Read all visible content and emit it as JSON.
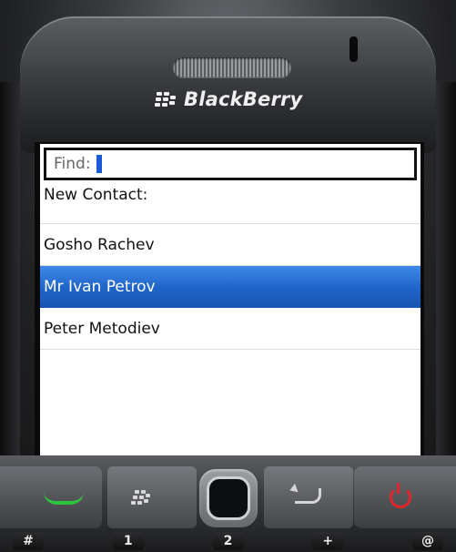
{
  "device": {
    "brand_text": "BlackBerry"
  },
  "screen": {
    "find": {
      "label": "Find:",
      "value": ""
    },
    "list": {
      "header": "New Contact:",
      "items": [
        {
          "label": "Gosho Rachev",
          "selected": false
        },
        {
          "label": "Mr Ivan Petrov",
          "selected": true
        },
        {
          "label": "Peter Metodiev",
          "selected": false
        }
      ]
    }
  },
  "keypad": {
    "row_keys": [
      "#",
      "1",
      "2",
      "+",
      "@"
    ]
  },
  "colors": {
    "selection": "#1f64c8",
    "call_green": "#2dc43f",
    "end_red": "#e0262b"
  }
}
